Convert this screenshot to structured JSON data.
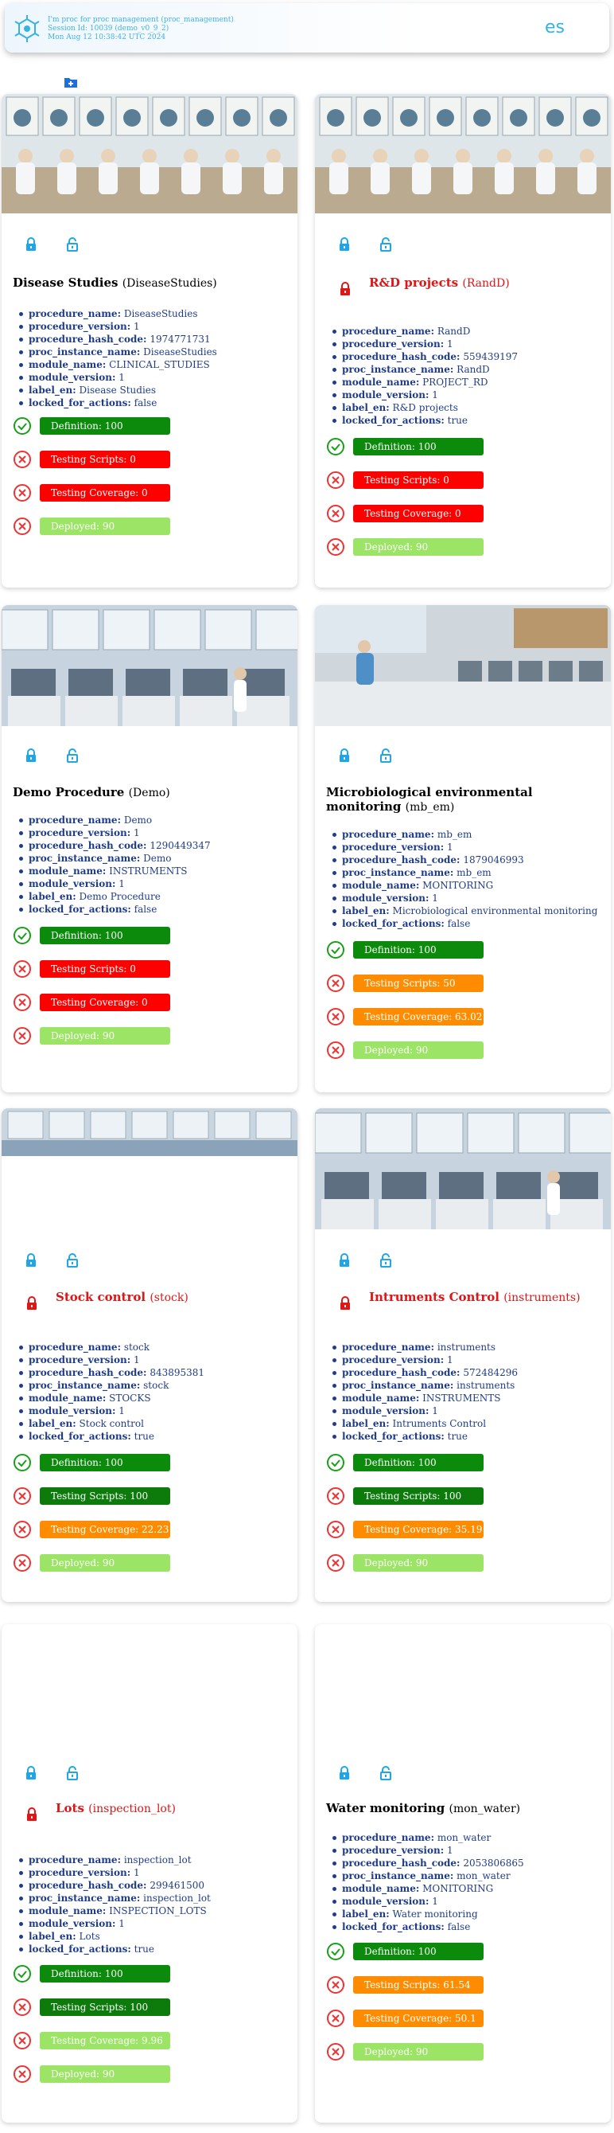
{
  "header": {
    "line1": "I'm proc for proc management (proc_management)",
    "line2": "Session Id: 10039 (demo_v0_9_2)",
    "line3": "Mon Aug 12 10:38:42 UTC 2024",
    "lang": "es"
  },
  "cards": [
    {
      "title": "Disease Studies",
      "code": "(DiseaseStudies)",
      "props": [
        {
          "k": "procedure_name:",
          "v": "DiseaseStudies"
        },
        {
          "k": "procedure_version:",
          "v": "1"
        },
        {
          "k": "procedure_hash_code:",
          "v": "1974771731"
        },
        {
          "k": "proc_instance_name:",
          "v": "DiseaseStudies"
        },
        {
          "k": "module_name:",
          "v": "CLINICAL_STUDIES"
        },
        {
          "k": "module_version:",
          "v": "1"
        },
        {
          "k": "label_en:",
          "v": "Disease Studies"
        },
        {
          "k": "locked_for_actions:",
          "v": "false"
        }
      ],
      "metrics": [
        {
          "label": "Definition: 100"
        },
        {
          "label": "Testing Scripts: 0"
        },
        {
          "label": "Testing Coverage: 0"
        },
        {
          "label": "Deployed: 90"
        }
      ]
    },
    {
      "title": "R&D projects",
      "code": "(RandD)",
      "props": [
        {
          "k": "procedure_name:",
          "v": "RandD"
        },
        {
          "k": "procedure_version:",
          "v": "1"
        },
        {
          "k": "procedure_hash_code:",
          "v": "559439197"
        },
        {
          "k": "proc_instance_name:",
          "v": "RandD"
        },
        {
          "k": "module_name:",
          "v": "PROJECT_RD"
        },
        {
          "k": "module_version:",
          "v": "1"
        },
        {
          "k": "label_en:",
          "v": "R&D projects"
        },
        {
          "k": "locked_for_actions:",
          "v": "true"
        }
      ],
      "metrics": [
        {
          "label": "Definition: 100"
        },
        {
          "label": "Testing Scripts: 0"
        },
        {
          "label": "Testing Coverage: 0"
        },
        {
          "label": "Deployed: 90"
        }
      ]
    },
    {
      "title": "Demo Procedure",
      "code": "(Demo)",
      "props": [
        {
          "k": "procedure_name:",
          "v": "Demo"
        },
        {
          "k": "procedure_version:",
          "v": "1"
        },
        {
          "k": "procedure_hash_code:",
          "v": "1290449347"
        },
        {
          "k": "proc_instance_name:",
          "v": "Demo"
        },
        {
          "k": "module_name:",
          "v": "INSTRUMENTS"
        },
        {
          "k": "module_version:",
          "v": "1"
        },
        {
          "k": "label_en:",
          "v": "Demo Procedure"
        },
        {
          "k": "locked_for_actions:",
          "v": "false"
        }
      ],
      "metrics": [
        {
          "label": "Definition: 100"
        },
        {
          "label": "Testing Scripts: 0"
        },
        {
          "label": "Testing Coverage: 0"
        },
        {
          "label": "Deployed: 90"
        }
      ]
    },
    {
      "title": "Microbiological environmental monitoring",
      "code": "(mb_em)",
      "props": [
        {
          "k": "procedure_name:",
          "v": "mb_em"
        },
        {
          "k": "procedure_version:",
          "v": "1"
        },
        {
          "k": "procedure_hash_code:",
          "v": "1879046993"
        },
        {
          "k": "proc_instance_name:",
          "v": "mb_em"
        },
        {
          "k": "module_name:",
          "v": "MONITORING"
        },
        {
          "k": "module_version:",
          "v": "1"
        },
        {
          "k": "label_en:",
          "v": "Microbiological environmental monitoring"
        },
        {
          "k": "locked_for_actions:",
          "v": "false"
        }
      ],
      "metrics": [
        {
          "label": "Definition: 100"
        },
        {
          "label": "Testing Scripts: 50"
        },
        {
          "label": "Testing Coverage: 63.02"
        },
        {
          "label": "Deployed: 90"
        }
      ]
    },
    {
      "title": "Stock control",
      "code": "(stock)",
      "props": [
        {
          "k": "procedure_name:",
          "v": "stock"
        },
        {
          "k": "procedure_version:",
          "v": "1"
        },
        {
          "k": "procedure_hash_code:",
          "v": "843895381"
        },
        {
          "k": "proc_instance_name:",
          "v": "stock"
        },
        {
          "k": "module_name:",
          "v": "STOCKS"
        },
        {
          "k": "module_version:",
          "v": "1"
        },
        {
          "k": "label_en:",
          "v": "Stock control"
        },
        {
          "k": "locked_for_actions:",
          "v": "true"
        }
      ],
      "metrics": [
        {
          "label": "Definition: 100"
        },
        {
          "label": "Testing Scripts: 100"
        },
        {
          "label": "Testing Coverage: 22.23"
        },
        {
          "label": "Deployed: 90"
        }
      ]
    },
    {
      "title": "Intruments Control",
      "code": "(instruments)",
      "props": [
        {
          "k": "procedure_name:",
          "v": "instruments"
        },
        {
          "k": "procedure_version:",
          "v": "1"
        },
        {
          "k": "procedure_hash_code:",
          "v": "572484296"
        },
        {
          "k": "proc_instance_name:",
          "v": "instruments"
        },
        {
          "k": "module_name:",
          "v": "INSTRUMENTS"
        },
        {
          "k": "module_version:",
          "v": "1"
        },
        {
          "k": "label_en:",
          "v": "Intruments Control"
        },
        {
          "k": "locked_for_actions:",
          "v": "true"
        }
      ],
      "metrics": [
        {
          "label": "Definition: 100"
        },
        {
          "label": "Testing Scripts: 100"
        },
        {
          "label": "Testing Coverage: 35.19"
        },
        {
          "label": "Deployed: 90"
        }
      ]
    },
    {
      "title": "Lots",
      "code": "(inspection_lot)",
      "props": [
        {
          "k": "procedure_name:",
          "v": "inspection_lot"
        },
        {
          "k": "procedure_version:",
          "v": "1"
        },
        {
          "k": "procedure_hash_code:",
          "v": "299461500"
        },
        {
          "k": "proc_instance_name:",
          "v": "inspection_lot"
        },
        {
          "k": "module_name:",
          "v": "INSPECTION_LOTS"
        },
        {
          "k": "module_version:",
          "v": "1"
        },
        {
          "k": "label_en:",
          "v": "Lots"
        },
        {
          "k": "locked_for_actions:",
          "v": "true"
        }
      ],
      "metrics": [
        {
          "label": "Definition: 100"
        },
        {
          "label": "Testing Scripts: 100"
        },
        {
          "label": "Testing Coverage: 9.96"
        },
        {
          "label": "Deployed: 90"
        }
      ]
    },
    {
      "title": "Water monitoring",
      "code": "(mon_water)",
      "props": [
        {
          "k": "procedure_name:",
          "v": "mon_water"
        },
        {
          "k": "procedure_version:",
          "v": "1"
        },
        {
          "k": "procedure_hash_code:",
          "v": "2053806865"
        },
        {
          "k": "proc_instance_name:",
          "v": "mon_water"
        },
        {
          "k": "module_name:",
          "v": "MONITORING"
        },
        {
          "k": "module_version:",
          "v": "1"
        },
        {
          "k": "label_en:",
          "v": "Water monitoring"
        },
        {
          "k": "locked_for_actions:",
          "v": "false"
        }
      ],
      "metrics": [
        {
          "label": "Definition: 100"
        },
        {
          "label": "Testing Scripts: 61.54"
        },
        {
          "label": "Testing Coverage: 50.1"
        },
        {
          "label": "Deployed: 90"
        }
      ]
    }
  ]
}
